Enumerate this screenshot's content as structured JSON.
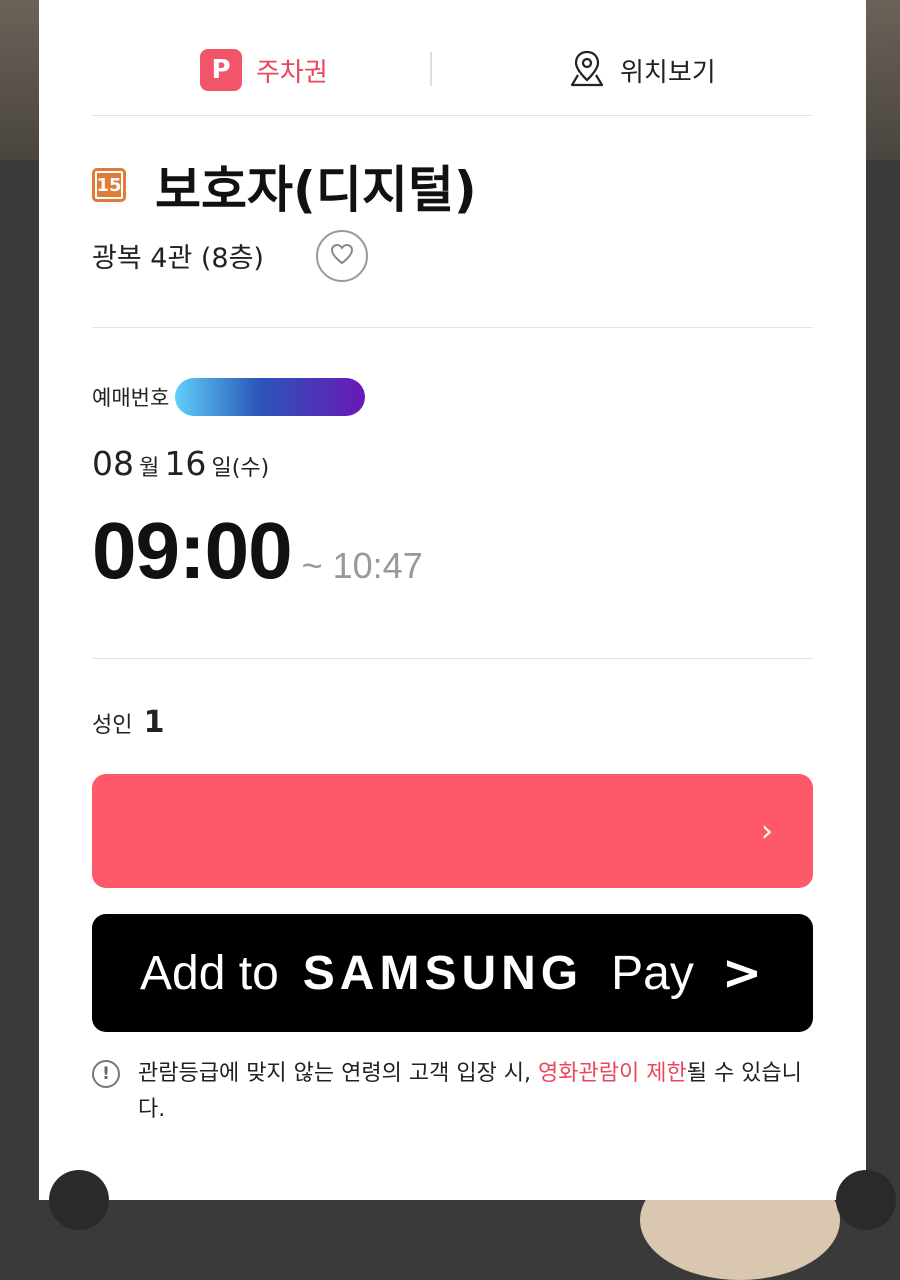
{
  "tabs": {
    "parking_icon": "P",
    "parking_label": "주차권",
    "location_label": "위치보기"
  },
  "movie": {
    "rating_badge": "15",
    "title": "보호자(디지털)",
    "theater": "광복 4관  (8층)"
  },
  "booking": {
    "number_label": "예매번호"
  },
  "schedule": {
    "month": "08",
    "month_unit": "월",
    "day": "16",
    "day_unit": "일(수)",
    "start_time": "09:00",
    "end_time": "~ 10:47"
  },
  "audience": {
    "label": "성인",
    "count": "1"
  },
  "actions": {
    "red_button_chevron": "›",
    "samsung_add": "Add to",
    "samsung_brand": "SAMSUNG",
    "samsung_pay": "Pay",
    "samsung_chevron": ">"
  },
  "notice": {
    "icon": "!",
    "text_before": "관람등급에 맞지 않는 연령의 고객 입장 시, ",
    "highlight": "영화관람이 제한",
    "text_after": "될 수 있습니다."
  },
  "colors": {
    "accent": "#e8475c",
    "red_button": "#fd5968",
    "rating_orange": "#e07b39"
  }
}
